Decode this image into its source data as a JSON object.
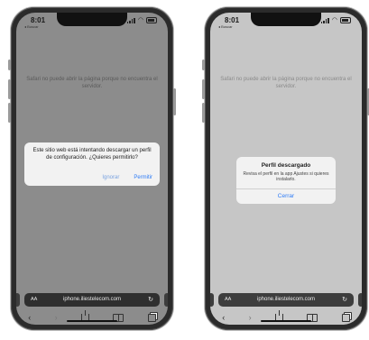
{
  "left_phone": {
    "status": {
      "time": "8:01",
      "back_label": "◂ Buscar"
    },
    "error_message": "Safari no puede abrir la página porque no encuentra el servidor.",
    "alert": {
      "message": "Este sitio web está intentando descargar un perfil de configuración. ¿Quieres permitirlo?",
      "ignore_label": "Ignorar",
      "allow_label": "Permitir"
    },
    "urlbar": {
      "aa": "AA",
      "url": "iphone.iliestelecom.com",
      "reload": "↻"
    },
    "toolbar": {
      "back": "‹",
      "forward": "›"
    }
  },
  "right_phone": {
    "status": {
      "time": "8:01",
      "back_label": "◂ Buscar"
    },
    "error_message": "Safari no puede abrir la página porque no encuentra el servidor.",
    "alert": {
      "title": "Perfil descargado",
      "subtitle": "Revisa el perfil en la app Ajustes si quieres instalarlo.",
      "close_label": "Cerrar"
    },
    "urlbar": {
      "aa": "AA",
      "url": "iphone.iliestelecom.com",
      "reload": "↻"
    },
    "toolbar": {
      "back": "‹",
      "forward": "›"
    }
  },
  "colors": {
    "link_blue": "#2f7cf6",
    "dim_overlay": "#8c8c8c"
  },
  "icons": [
    "signal-icon",
    "wifi-icon",
    "battery-icon",
    "reload-icon",
    "back-icon",
    "forward-icon",
    "share-icon",
    "bookmarks-icon",
    "tabs-icon"
  ]
}
